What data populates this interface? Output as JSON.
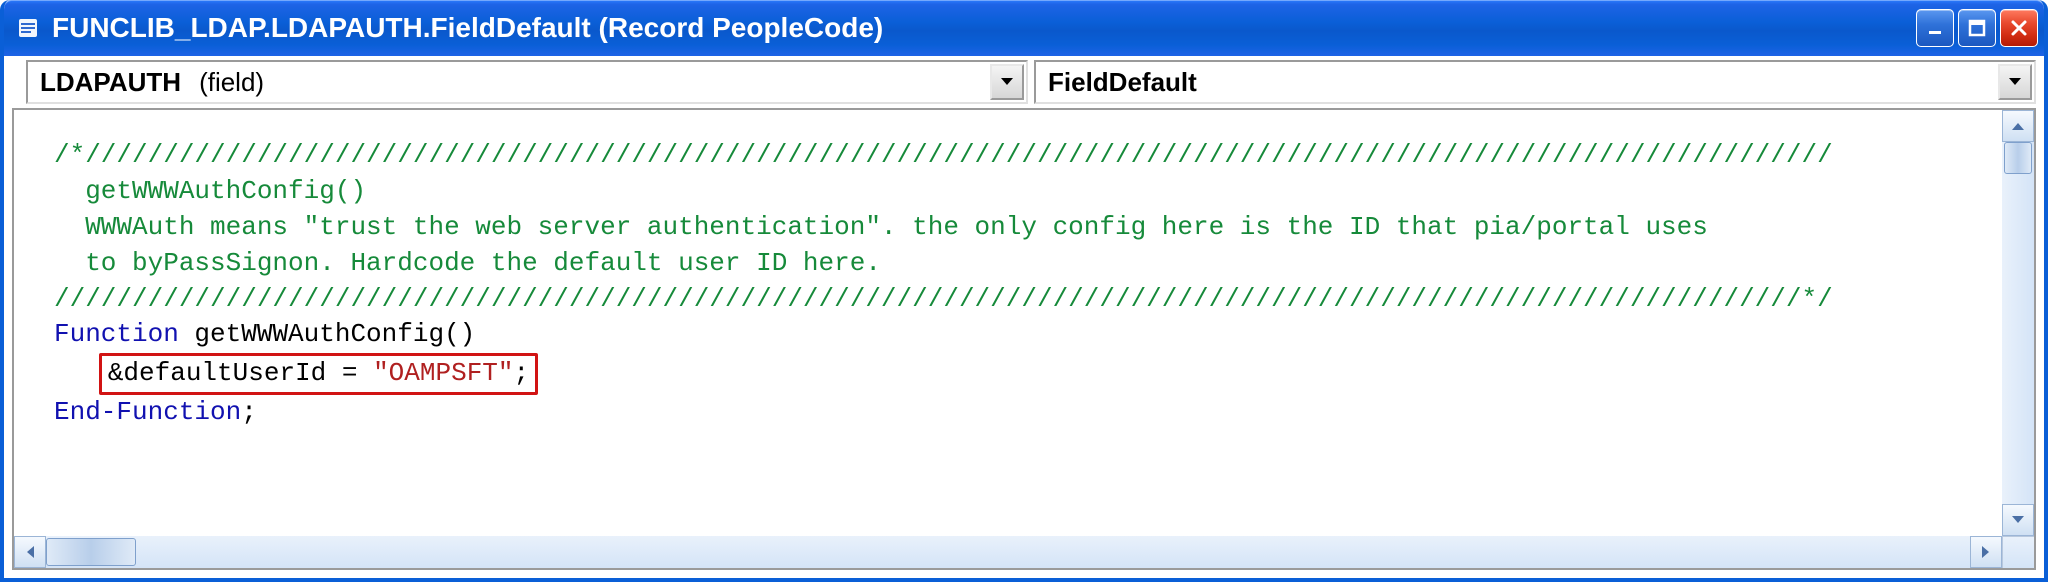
{
  "window": {
    "title": "FUNCLIB_LDAP.LDAPAUTH.FieldDefault (Record PeopleCode)"
  },
  "dropdowns": {
    "left_field": "LDAPAUTH",
    "left_sub": "(field)",
    "right_value": "FieldDefault"
  },
  "code": {
    "comment_border": "/*////////////////////////////////////////////////////////////////////////////////////////////////////////////////",
    "comment_line1": "  getWWWAuthConfig()",
    "comment_line2": "  WWWAuth means \"trust the web server authentication\". the only config here is the ID that pia/portal uses",
    "comment_line3": "  to byPassSignon. Hardcode the default user ID here.",
    "comment_border_end": "////////////////////////////////////////////////////////////////////////////////////////////////////////////////*/",
    "kw_function": "Function",
    "fn_name": " getWWWAuthConfig()",
    "assign_var": "&defaultUserId ",
    "assign_eq": "= ",
    "assign_str": "\"OAMPSFT\"",
    "assign_semi": ";",
    "kw_endfunction": "End-Function",
    "endfunction_semi": ";"
  }
}
